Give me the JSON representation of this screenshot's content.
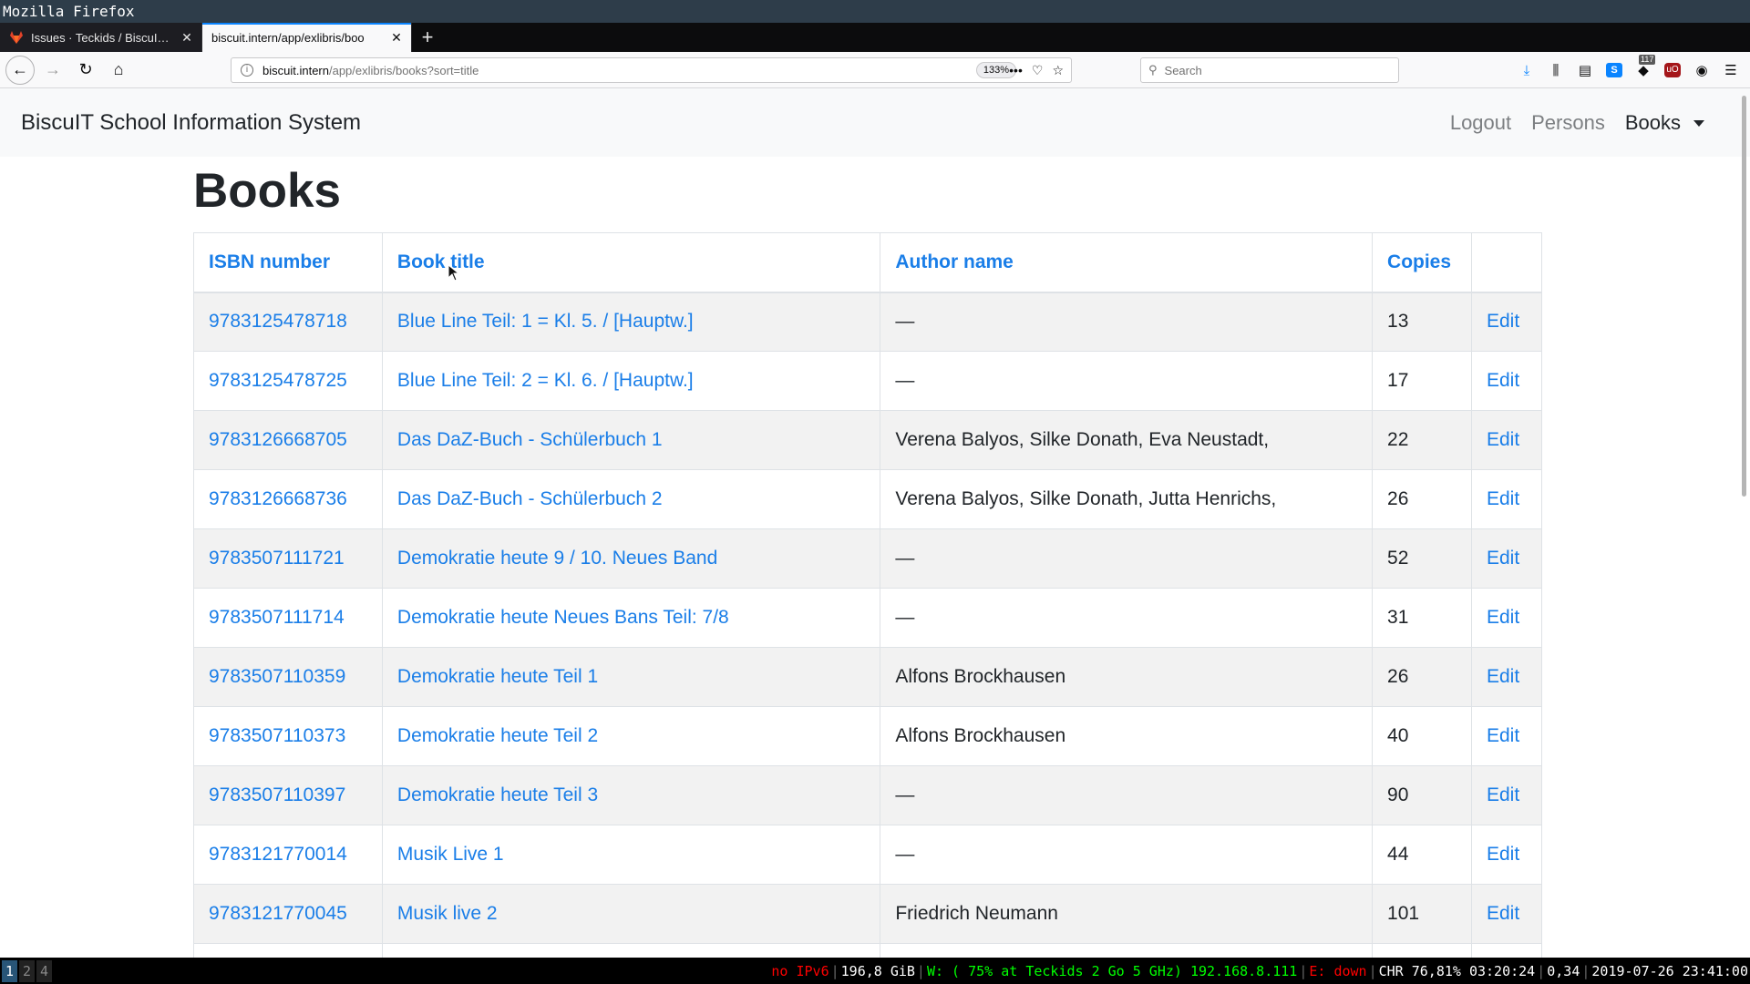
{
  "window": {
    "title": "Mozilla Firefox"
  },
  "tabs": [
    {
      "label": "Issues · Teckids / BiscuIT / E",
      "icon": "gitlab-icon",
      "active": false
    },
    {
      "label": "biscuit.intern/app/exlibris/boo",
      "icon": "",
      "active": true
    }
  ],
  "browser": {
    "url_host": "biscuit.intern",
    "url_path": "/app/exlibris/books?sort=title",
    "zoom": "133%",
    "search_placeholder": "Search",
    "extension_badge": "117"
  },
  "app": {
    "brand": "BiscuIT School Information System",
    "nav": {
      "logout": "Logout",
      "persons": "Persons",
      "books": "Books"
    }
  },
  "page": {
    "title": "Books",
    "table": {
      "headers": {
        "isbn": "ISBN number",
        "title": "Book title",
        "author": "Author name",
        "copies": "Copies"
      },
      "edit_label": "Edit",
      "rows": [
        {
          "isbn": "9783125478718",
          "title": "Blue Line Teil: 1 = Kl. 5. / [Hauptw.]",
          "author": "—",
          "copies": "13"
        },
        {
          "isbn": "9783125478725",
          "title": "Blue Line Teil: 2 = Kl. 6. / [Hauptw.]",
          "author": "—",
          "copies": "17"
        },
        {
          "isbn": "9783126668705",
          "title": "Das DaZ-Buch - Schülerbuch 1",
          "author": "Verena Balyos, Silke Donath, Eva Neustadt,",
          "copies": "22"
        },
        {
          "isbn": "9783126668736",
          "title": "Das DaZ-Buch - Schülerbuch 2",
          "author": "Verena Balyos, Silke Donath, Jutta Henrichs,",
          "copies": "26"
        },
        {
          "isbn": "9783507111721",
          "title": "Demokratie heute 9 / 10. Neues Band",
          "author": "—",
          "copies": "52"
        },
        {
          "isbn": "9783507111714",
          "title": "Demokratie heute Neues Bans Teil: 7/8",
          "author": "—",
          "copies": "31"
        },
        {
          "isbn": "9783507110359",
          "title": "Demokratie heute Teil 1",
          "author": "Alfons Brockhausen",
          "copies": "26"
        },
        {
          "isbn": "9783507110373",
          "title": "Demokratie heute Teil 2",
          "author": "Alfons Brockhausen",
          "copies": "40"
        },
        {
          "isbn": "9783507110397",
          "title": "Demokratie heute Teil 3",
          "author": "—",
          "copies": "90"
        },
        {
          "isbn": "9783121770014",
          "title": "Musik Live 1",
          "author": "—",
          "copies": "44"
        },
        {
          "isbn": "9783121770045",
          "title": "Musik live 2",
          "author": "Friedrich Neumann",
          "copies": "101"
        },
        {
          "isbn": "",
          "title": "",
          "author": "",
          "copies": ""
        }
      ]
    }
  },
  "statusbar": {
    "workspaces": [
      "1",
      "2",
      "4"
    ],
    "ipv6": "no IPv6",
    "disk": "196,8 GiB",
    "wifi": "W: ( 75% at Teckids 2 Go 5 GHz) 192.168.8.111",
    "ethernet": "E: down",
    "battery": "CHR 76,81% 03:20:24",
    "load": "0,34",
    "datetime": "2019-07-26 23:41:00"
  },
  "colors": {
    "link": "#1a7ee8",
    "text": "#212529",
    "navbar_bg": "#f8f9fa",
    "stripe": "#f2f2f2"
  }
}
